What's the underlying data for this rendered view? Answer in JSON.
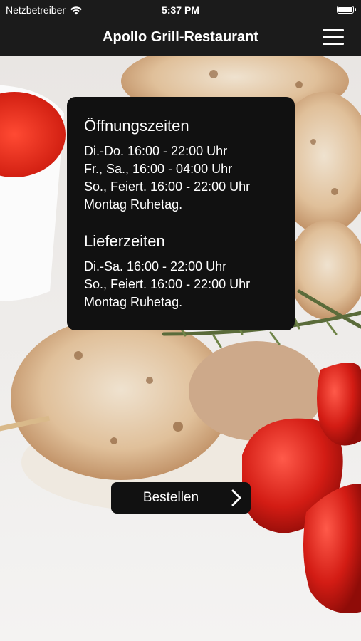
{
  "status_bar": {
    "carrier": "Netzbetreiber",
    "time": "5:37 PM",
    "wifi_icon": "wifi-icon",
    "battery_icon": "battery-icon"
  },
  "nav": {
    "title": "Apollo Grill-Restaurant",
    "menu_icon": "hamburger-menu-icon"
  },
  "info": {
    "opening_title": "Öffnungszeiten",
    "opening_lines": [
      "Di.-Do. 16:00 - 22:00 Uhr",
      "Fr., Sa., 16:00 - 04:00 Uhr",
      "So., Feiert. 16:00 - 22:00 Uhr",
      "Montag Ruhetag."
    ],
    "delivery_title": "Lieferzeiten",
    "delivery_lines": [
      "Di.-Sa. 16:00 - 22:00 Uhr",
      "So., Feiert. 16:00 - 22:00 Uhr",
      "Montag Ruhetag."
    ]
  },
  "order_button": {
    "label": "Bestellen",
    "icon": "chevron-right-icon"
  },
  "colors": {
    "bar": "#1b1b1b",
    "card": "#111111",
    "text": "#ffffff"
  }
}
